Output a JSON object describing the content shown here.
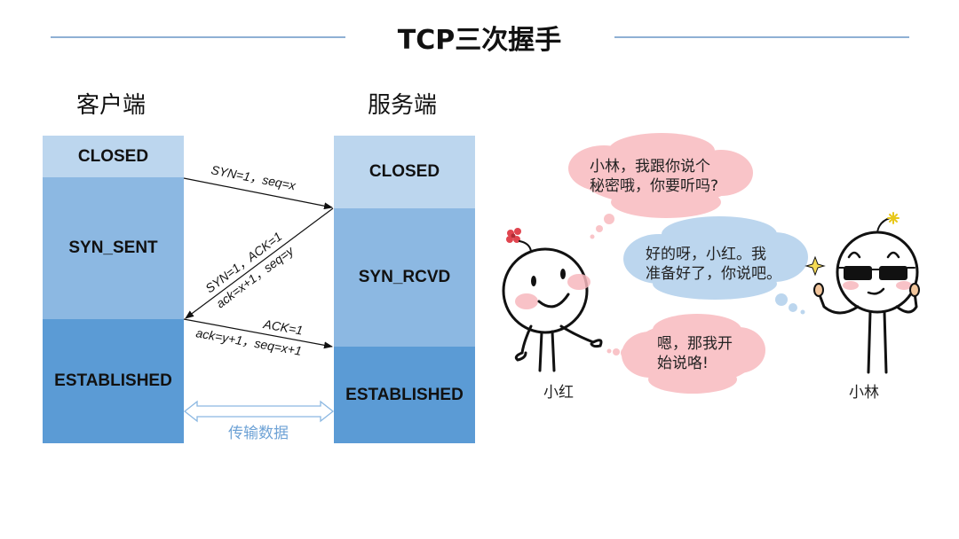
{
  "title": "TCP三次握手",
  "client": {
    "label": "客户端",
    "states": [
      "CLOSED",
      "SYN_SENT",
      "ESTABLISHED"
    ]
  },
  "server": {
    "label": "服务端",
    "states": [
      "CLOSED",
      "SYN_RCVD",
      "ESTABLISHED"
    ]
  },
  "messages": [
    {
      "direction": "client-to-server",
      "lines": [
        "SYN=1，seq=x"
      ]
    },
    {
      "direction": "server-to-client",
      "lines": [
        "SYN=1，ACK=1",
        "ack=x+1，seq=y"
      ]
    },
    {
      "direction": "client-to-server",
      "lines": [
        "ACK=1",
        "ack=y+1，seq=x+1"
      ]
    }
  ],
  "data_transfer_label": "传输数据",
  "comic": {
    "characters": [
      {
        "name": "小红",
        "accessory": "flower-icon"
      },
      {
        "name": "小林",
        "accessory": "sunglasses-icon"
      }
    ],
    "bubbles": [
      {
        "speaker": "小红",
        "color": "#f9c4c8",
        "lines": [
          "小林，我跟你说个",
          "秘密哦，你要听吗?"
        ]
      },
      {
        "speaker": "小林",
        "color": "#bcd6ee",
        "lines": [
          "好的呀，小红。我",
          "准备好了，你说吧。"
        ]
      },
      {
        "speaker": "小红",
        "color": "#f9c4c8",
        "lines": [
          "嗯，那我开",
          "始说咯!"
        ]
      }
    ]
  },
  "colors": {
    "closed": "#bcd6ee",
    "syn": "#8cb8e2",
    "established": "#5b9bd5",
    "title_rule": "#8fb0d4",
    "data_arrow": "#6fa3d6"
  }
}
